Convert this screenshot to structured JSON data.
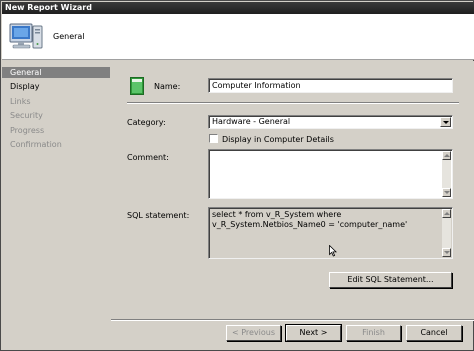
{
  "window": {
    "title": "New Report Wizard"
  },
  "header": {
    "title": "General",
    "icon": "computer-icon"
  },
  "sidebar": {
    "items": [
      {
        "label": "General",
        "state": "selected"
      },
      {
        "label": "Display",
        "state": "active"
      },
      {
        "label": "Links",
        "state": "disabled"
      },
      {
        "label": "Security",
        "state": "disabled"
      },
      {
        "label": "Progress",
        "state": "disabled"
      },
      {
        "label": "Confirmation",
        "state": "disabled"
      }
    ]
  },
  "form": {
    "page_icon": "report-page-icon",
    "name_label": "Name:",
    "name_value": "Computer Information",
    "category_label": "Category:",
    "category_value": "Hardware - General",
    "display_checkbox_label": "Display in Computer Details",
    "display_checked": false,
    "comment_label": "Comment:",
    "comment_value": "",
    "sql_label": "SQL statement:",
    "sql_value": "select * from v_R_System where v_R_System.Netbios_Name0 = 'computer_name'",
    "edit_sql_label": "Edit SQL Statement..."
  },
  "footer": {
    "previous_label": "< Previous",
    "next_label": "Next >",
    "finish_label": "Finish",
    "cancel_label": "Cancel"
  },
  "colors": {
    "titlebar": "#1f1f1f",
    "sidebar_selected": "#808080",
    "window_bg": "#d4d0c8"
  }
}
